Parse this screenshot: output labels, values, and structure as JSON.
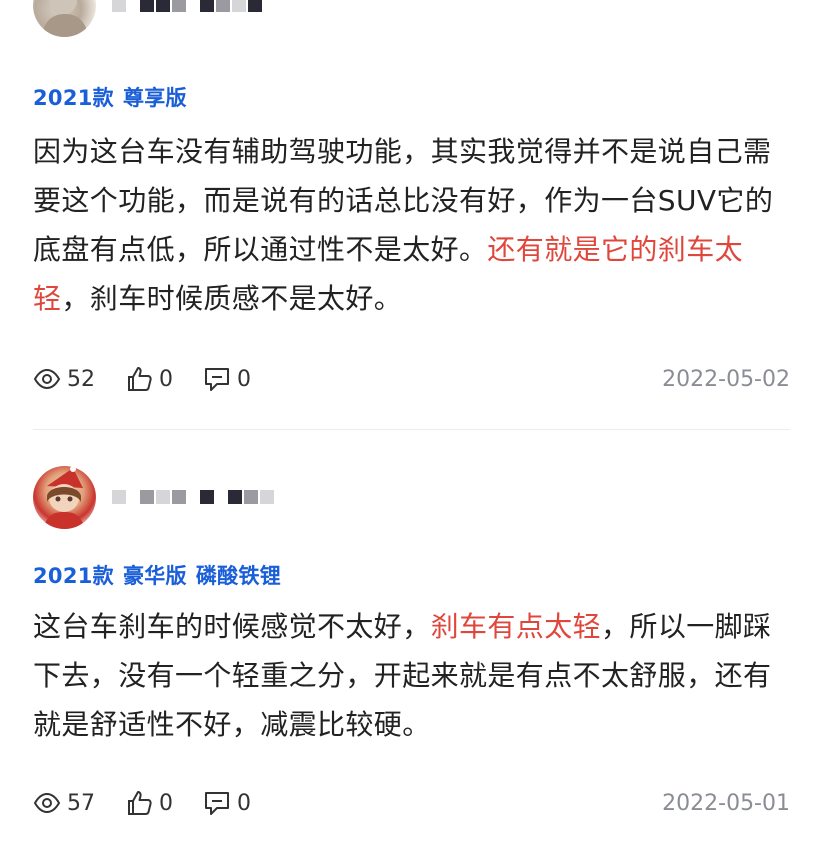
{
  "reviews": [
    {
      "trim_tags": [
        "2021款",
        "尊享版"
      ],
      "content": {
        "text_before": "因为这台车没有辅助驾驶功能，其实我觉得并不是说自己需要这个功能，而是说有的话总比没有好，作为一台SUV它的底盘有点低，所以通过性不是太好。",
        "highlight": "还有就是它的刹车太轻",
        "text_after": "，刹车时候质感不是太好。"
      },
      "stats": {
        "views": "52",
        "likes": "0",
        "comments": "0"
      },
      "date": "2022-05-02"
    },
    {
      "trim_tags": [
        "2021款",
        "豪华版",
        "磷酸铁锂"
      ],
      "content": {
        "text_before": "这台车刹车的时候感觉不太好，",
        "highlight": "刹车有点太轻",
        "text_after": "，所以一脚踩下去，没有一个轻重之分，开起来就是有点不太舒服，还有就是舒适性不好，减震比较硬。"
      },
      "stats": {
        "views": "57",
        "likes": "0",
        "comments": "0"
      },
      "date": "2022-05-01"
    }
  ],
  "icons": {
    "views": "eye-icon",
    "likes": "thumbs-up-icon",
    "comments": "comment-icon"
  },
  "colors": {
    "trim_tag": "#1a5ed8",
    "highlight": "#e0473c",
    "date": "#8a8d95"
  }
}
